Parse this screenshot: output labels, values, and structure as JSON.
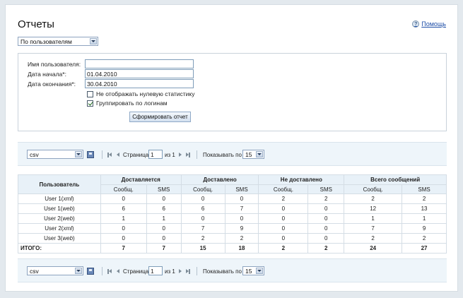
{
  "header": {
    "title": "Отчеты",
    "help_label": "Помощь",
    "help_icon": "?"
  },
  "report_type": {
    "selected": "По пользователям"
  },
  "form": {
    "username_label": "Имя пользователя:",
    "username_value": "",
    "start_label": "Дата начала*:",
    "start_value": "01.04.2010",
    "end_label": "Дата окончания*:",
    "end_value": "30.04.2010",
    "hide_zero_label": "Не отображать нулевую статистику",
    "hide_zero_checked": false,
    "group_label": "Группировать по логинам",
    "group_checked": true,
    "submit_label": "Сформировать отчет"
  },
  "pager": {
    "export_format": "csv",
    "page_label": "Страница",
    "page_value": "1",
    "of_label": "из 1",
    "show_by_label": "Показывать по",
    "show_by_value": "15"
  },
  "table": {
    "col_user": "Пользователь",
    "groups": [
      "Доставляется",
      "Доставлено",
      "Не доставлено",
      "Всего сообщений"
    ],
    "sub_msg": "Сообщ.",
    "sub_sms": "SMS",
    "rows": [
      {
        "user": "User 1",
        "type": "xml",
        "v": [
          "0",
          "0",
          "0",
          "0",
          "2",
          "2",
          "2",
          "2"
        ]
      },
      {
        "user": "User 1",
        "type": "web",
        "v": [
          "6",
          "6",
          "6",
          "7",
          "0",
          "0",
          "12",
          "13"
        ]
      },
      {
        "user": "User 2",
        "type": "web",
        "v": [
          "1",
          "1",
          "0",
          "0",
          "0",
          "0",
          "1",
          "1"
        ]
      },
      {
        "user": "User 2",
        "type": "xml",
        "v": [
          "0",
          "0",
          "7",
          "9",
          "0",
          "0",
          "7",
          "9"
        ]
      },
      {
        "user": "User 3",
        "type": "web",
        "v": [
          "0",
          "0",
          "2",
          "2",
          "0",
          "0",
          "2",
          "2"
        ]
      }
    ],
    "total_label": "ИТОГО:",
    "totals": [
      "7",
      "7",
      "15",
      "18",
      "2",
      "2",
      "24",
      "27"
    ]
  }
}
